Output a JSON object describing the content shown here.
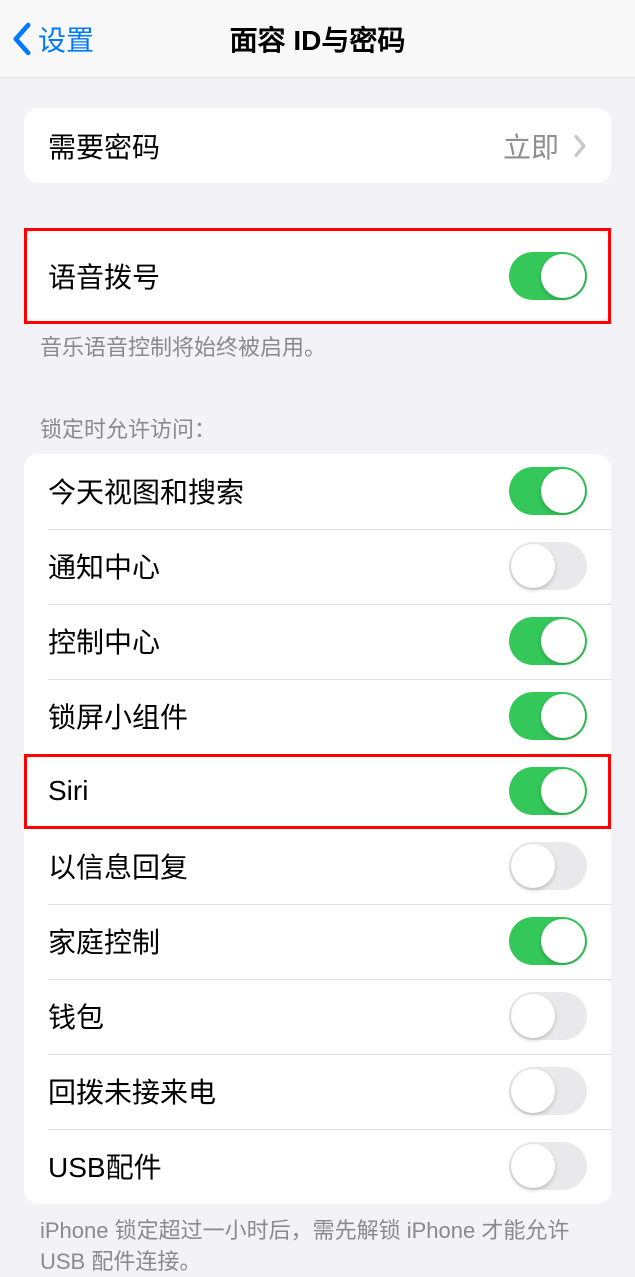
{
  "nav": {
    "back_label": "设置",
    "title": "面容 ID与密码"
  },
  "group1": {
    "require_passcode_label": "需要密码",
    "require_passcode_value": "立即"
  },
  "group2": {
    "voice_dial_label": "语音拨号",
    "voice_dial_on": true,
    "footer": "音乐语音控制将始终被启用。"
  },
  "group3": {
    "header": "锁定时允许访问：",
    "items": [
      {
        "label": "今天视图和搜索",
        "on": true
      },
      {
        "label": "通知中心",
        "on": false
      },
      {
        "label": "控制中心",
        "on": true
      },
      {
        "label": "锁屏小组件",
        "on": true
      },
      {
        "label": "Siri",
        "on": true
      },
      {
        "label": "以信息回复",
        "on": false
      },
      {
        "label": "家庭控制",
        "on": true
      },
      {
        "label": "钱包",
        "on": false
      },
      {
        "label": "回拨未接来电",
        "on": false
      },
      {
        "label": "USB配件",
        "on": false
      }
    ],
    "footer": "iPhone 锁定超过一小时后，需先解锁 iPhone 才能允许USB 配件连接。"
  }
}
